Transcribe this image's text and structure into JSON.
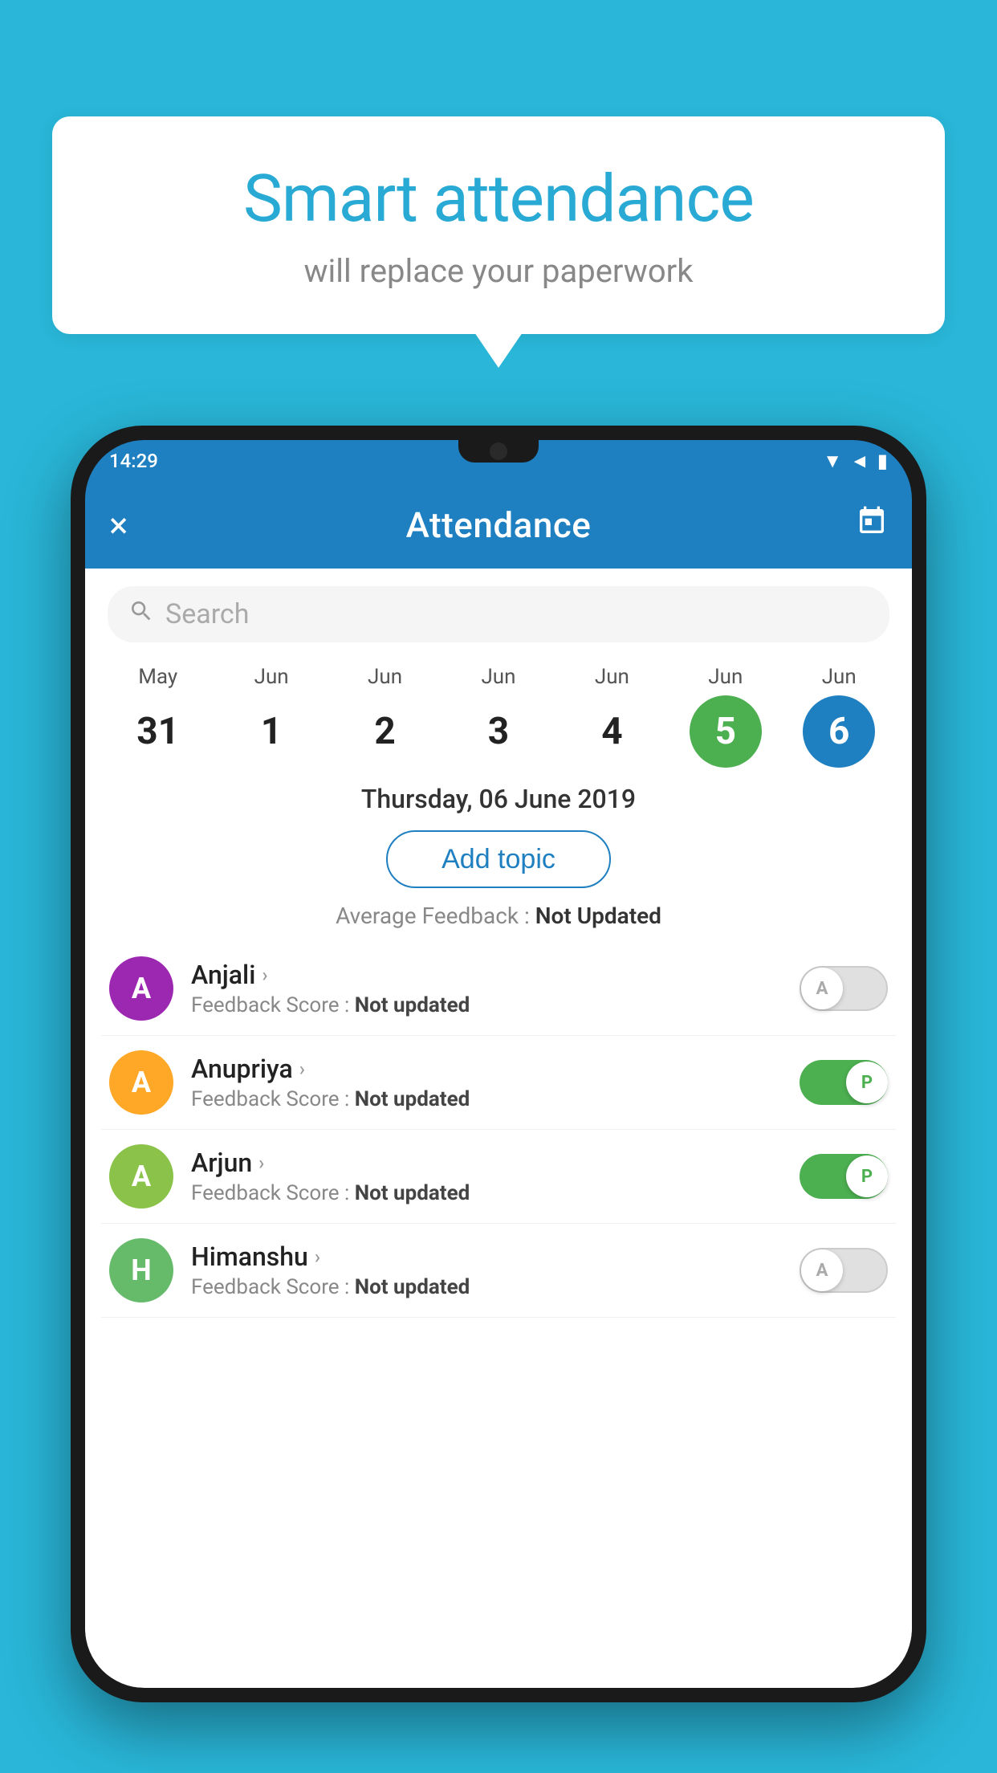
{
  "background_color": "#29b6d8",
  "bubble": {
    "title": "Smart attendance",
    "subtitle": "will replace your paperwork"
  },
  "status_bar": {
    "time": "14:29",
    "wifi": "wifi",
    "signal": "signal",
    "battery": "battery"
  },
  "top_bar": {
    "title": "Attendance",
    "close_label": "×",
    "calendar_icon": "calendar-icon"
  },
  "search": {
    "placeholder": "Search"
  },
  "calendar": {
    "dates": [
      {
        "month": "May",
        "day": "31",
        "style": "normal"
      },
      {
        "month": "Jun",
        "day": "1",
        "style": "normal"
      },
      {
        "month": "Jun",
        "day": "2",
        "style": "normal"
      },
      {
        "month": "Jun",
        "day": "3",
        "style": "normal"
      },
      {
        "month": "Jun",
        "day": "4",
        "style": "normal"
      },
      {
        "month": "Jun",
        "day": "5",
        "style": "today"
      },
      {
        "month": "Jun",
        "day": "6",
        "style": "selected"
      }
    ],
    "selected_date_label": "Thursday, 06 June 2019"
  },
  "add_topic_label": "Add topic",
  "avg_feedback_label": "Average Feedback :",
  "avg_feedback_value": "Not Updated",
  "students": [
    {
      "name": "Anjali",
      "avatar_letter": "A",
      "avatar_color": "#9c27b0",
      "feedback_label": "Feedback Score :",
      "feedback_value": "Not updated",
      "toggle_state": "off",
      "toggle_label": "A"
    },
    {
      "name": "Anupriya",
      "avatar_letter": "A",
      "avatar_color": "#ffa726",
      "feedback_label": "Feedback Score :",
      "feedback_value": "Not updated",
      "toggle_state": "on",
      "toggle_label": "P"
    },
    {
      "name": "Arjun",
      "avatar_letter": "A",
      "avatar_color": "#8bc34a",
      "feedback_label": "Feedback Score :",
      "feedback_value": "Not updated",
      "toggle_state": "on",
      "toggle_label": "P"
    },
    {
      "name": "Himanshu",
      "avatar_letter": "H",
      "avatar_color": "#66bb6a",
      "feedback_label": "Feedback Score :",
      "feedback_value": "Not updated",
      "toggle_state": "off",
      "toggle_label": "A"
    }
  ]
}
